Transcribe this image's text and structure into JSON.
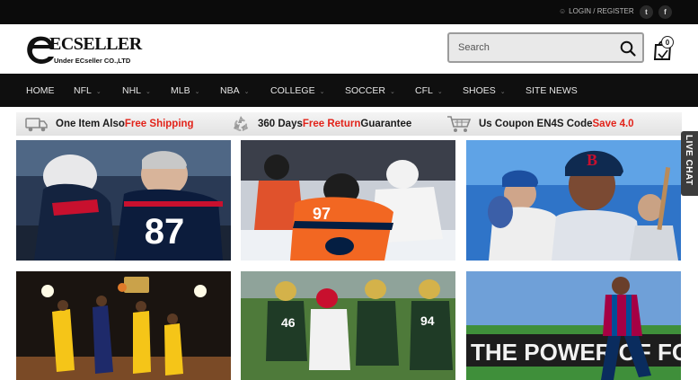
{
  "topbar": {
    "login_label": "LOGIN / REGISTER",
    "social": [
      {
        "icon": "twitter-icon",
        "glyph": "t"
      },
      {
        "icon": "facebook-icon",
        "glyph": "f"
      }
    ]
  },
  "header": {
    "logo_main": "ECSELLER",
    "logo_sub": "Under ECseller CO.,LTD",
    "search_placeholder": "Search",
    "cart_count": "0"
  },
  "nav": {
    "items": [
      {
        "label": "HOME",
        "dropdown": false
      },
      {
        "label": "NFL",
        "dropdown": true
      },
      {
        "label": "NHL",
        "dropdown": true
      },
      {
        "label": "MLB",
        "dropdown": true
      },
      {
        "label": "NBA",
        "dropdown": true
      },
      {
        "label": "COLLEGE",
        "dropdown": true
      },
      {
        "label": "SOCCER",
        "dropdown": true
      },
      {
        "label": "CFL",
        "dropdown": true
      },
      {
        "label": "SHOES",
        "dropdown": true
      },
      {
        "label": "SITE NEWS",
        "dropdown": false
      }
    ]
  },
  "promo": {
    "items": [
      {
        "icon": "truck-icon",
        "text": "One Item Also ",
        "highlight": "Free Shipping",
        "after": ""
      },
      {
        "icon": "recycle-icon",
        "text": "360 Days ",
        "highlight": "Free Return",
        "after": " Guarantee"
      },
      {
        "icon": "shopping-cart-icon",
        "text": "Us Coupon EN4S Code ",
        "highlight": "Save 4.0",
        "after": ""
      }
    ]
  },
  "tiles": {
    "jersey_text_football": "87",
    "jersey_text_hockey": "97",
    "banner_text_soccer": "THE POWER OF FO"
  },
  "livechat": {
    "label": "LIVE CHAT"
  },
  "colors": {
    "accent_red": "#e2231a",
    "nav_bg": "#0f0f0f",
    "topbar_bg": "#0b0b0b"
  }
}
